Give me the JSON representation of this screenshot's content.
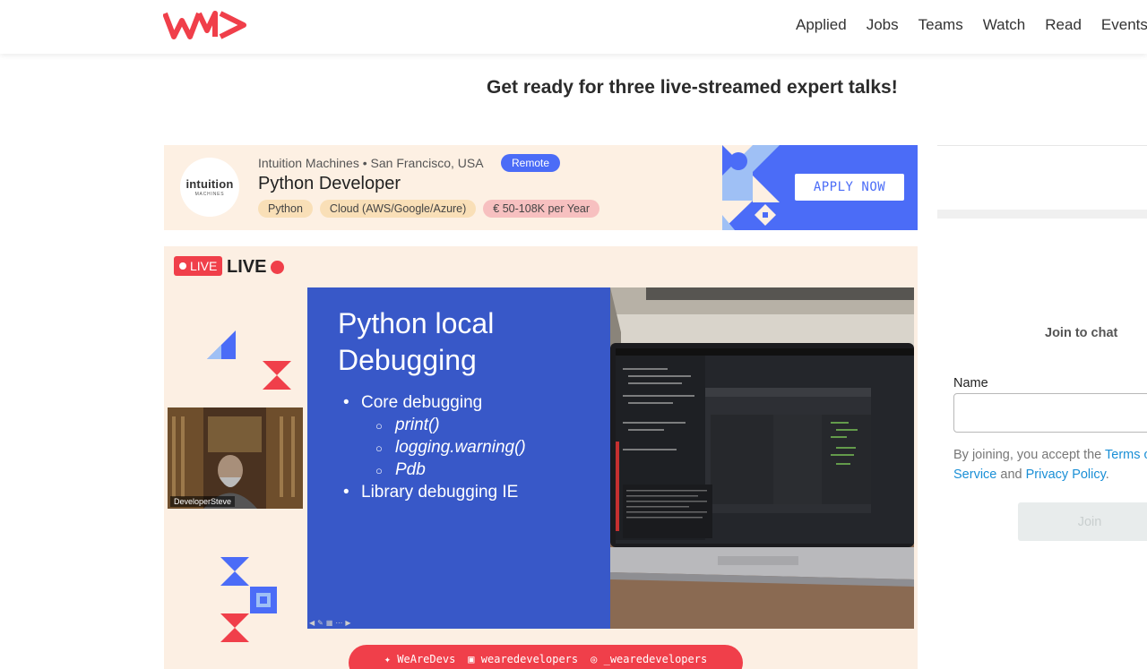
{
  "header": {
    "nav": [
      "Applied",
      "Jobs",
      "Teams",
      "Watch",
      "Read",
      "Events"
    ]
  },
  "headline": "Get ready for three live-streamed expert talks!",
  "job_ad": {
    "company_logo_text": "intuition",
    "company_logo_sub": "MACHINES",
    "meta": "Intuition Machines • San Francisco, USA",
    "badge": "Remote",
    "title": "Python Developer",
    "tags": [
      "Python",
      "Cloud (AWS/Google/Azure)",
      "€ 50-108K per Year"
    ],
    "apply_label": "APPLY NOW"
  },
  "stream": {
    "live_badge": "LIVE",
    "live_label": "LIVE",
    "slide": {
      "title_line1": "Python local",
      "title_line2": "Debugging",
      "items": [
        "Core debugging",
        "print()",
        "logging.warning()",
        "Pdb",
        "Library debugging IE"
      ]
    },
    "webcam_name": "DeveloperSteve",
    "social": {
      "twitter": "WeAreDevs",
      "facebook": "wearedevelopers",
      "instagram": "_wearedevelopers"
    }
  },
  "chat": {
    "title": "Join to chat",
    "name_label": "Name",
    "terms_prefix": "By joining, you accept the",
    "terms_link": "Terms of Service",
    "terms_and": "and",
    "privacy_link": "Privacy Policy",
    "join_label": "Join"
  },
  "colors": {
    "brand_red": "#f03f4a",
    "accent_blue": "#4b6cf7"
  }
}
